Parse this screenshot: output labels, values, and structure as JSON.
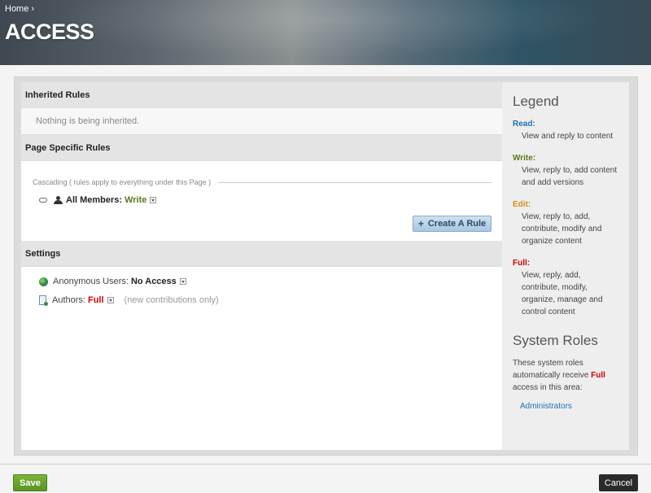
{
  "header": {
    "breadcrumb": "Home ›",
    "title": "ACCESS"
  },
  "inherited": {
    "heading": "Inherited Rules",
    "message": "Nothing is being inherited."
  },
  "page_rules": {
    "heading": "Page Specific Rules",
    "cascading": "Cascading   ( rules apply to everything under this Page )",
    "member_label": "All Members:",
    "member_perm": "Write",
    "create_button": "Create A Rule",
    "create_plus": "+"
  },
  "settings": {
    "heading": "Settings",
    "anon_label": "Anonymous Users:",
    "anon_perm": "No Access",
    "authors_label": "Authors:",
    "authors_perm": "Full",
    "authors_note": "(new contributions only)"
  },
  "legend": {
    "title": "Legend",
    "items": [
      {
        "term": "Read:",
        "desc": "View and reply to content"
      },
      {
        "term": "Write:",
        "desc": "View, reply to, add content and add versions"
      },
      {
        "term": "Edit:",
        "desc": "View, reply to, add, contribute, modify and organize content"
      },
      {
        "term": "Full:",
        "desc": "View, reply, add, contribute, modify, organize, manage and control content"
      }
    ],
    "system_title": "System Roles",
    "system_text_1": "These system roles automatically receive ",
    "system_text_bold": "Full",
    "system_text_2": " access in this area:",
    "system_role": "Administrators"
  },
  "footer": {
    "save": "Save",
    "cancel": "Cancel"
  },
  "colors": {
    "read": "#1f6fb8",
    "write": "#5a7a1a",
    "edit": "#d38a1f",
    "full": "#cc0000",
    "save_button": "#5a9425",
    "cancel_button": "#2a2a2a"
  },
  "icons": [
    "link-icon",
    "people-icon",
    "globe-icon",
    "document-icon",
    "dropdown-arrow-icon",
    "plus-icon"
  ]
}
